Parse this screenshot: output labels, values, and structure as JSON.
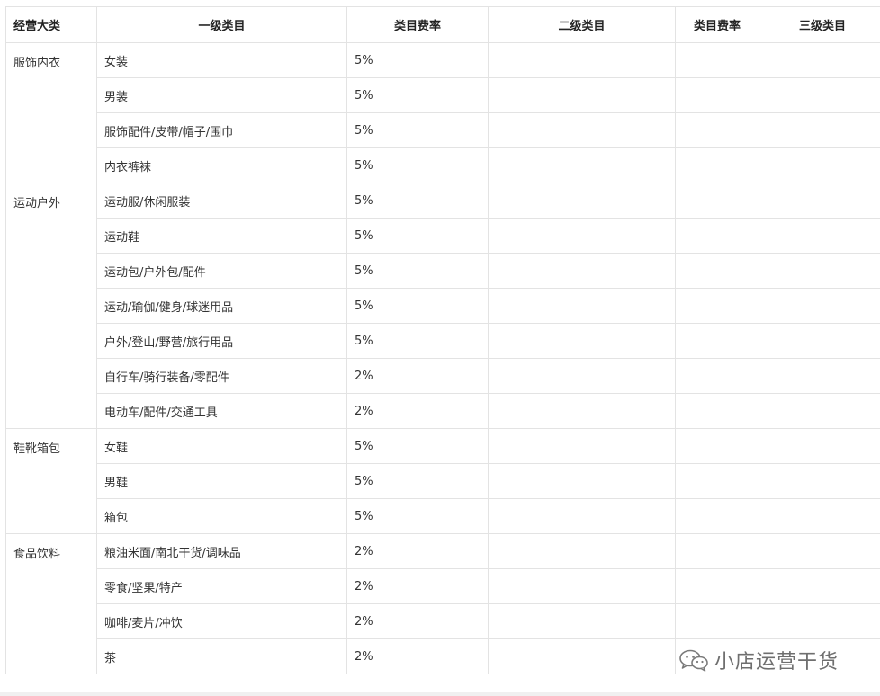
{
  "table": {
    "headers": [
      "经营大类",
      "一级类目",
      "类目费率",
      "二级类目",
      "类目费率",
      "三级类目"
    ],
    "groups": [
      {
        "name": "服饰内衣",
        "rows": [
          {
            "category": "女装",
            "rate": "5%"
          },
          {
            "category": "男装",
            "rate": "5%"
          },
          {
            "category": "服饰配件/皮带/帽子/围巾",
            "rate": "5%"
          },
          {
            "category": "内衣裤袜",
            "rate": "5%"
          }
        ]
      },
      {
        "name": "运动户外",
        "rows": [
          {
            "category": "运动服/休闲服装",
            "rate": "5%"
          },
          {
            "category": "运动鞋",
            "rate": "5%"
          },
          {
            "category": "运动包/户外包/配件",
            "rate": "5%"
          },
          {
            "category": "运动/瑜伽/健身/球迷用品",
            "rate": "5%"
          },
          {
            "category": "户外/登山/野营/旅行用品",
            "rate": "5%"
          },
          {
            "category": "自行车/骑行装备/零配件",
            "rate": "2%"
          },
          {
            "category": "电动车/配件/交通工具",
            "rate": "2%"
          }
        ]
      },
      {
        "name": "鞋靴箱包",
        "rows": [
          {
            "category": "女鞋",
            "rate": "5%"
          },
          {
            "category": "男鞋",
            "rate": "5%"
          },
          {
            "category": "箱包",
            "rate": "5%"
          }
        ]
      },
      {
        "name": "食品饮料",
        "rows": [
          {
            "category": "粮油米面/南北干货/调味品",
            "rate": "2%"
          },
          {
            "category": "零食/坚果/特产",
            "rate": "2%"
          },
          {
            "category": "咖啡/麦片/冲饮",
            "rate": "2%"
          },
          {
            "category": "茶",
            "rate": "2%"
          }
        ]
      }
    ]
  },
  "watermark": {
    "text": "小店运营干货",
    "icon": "wechat-icon"
  }
}
